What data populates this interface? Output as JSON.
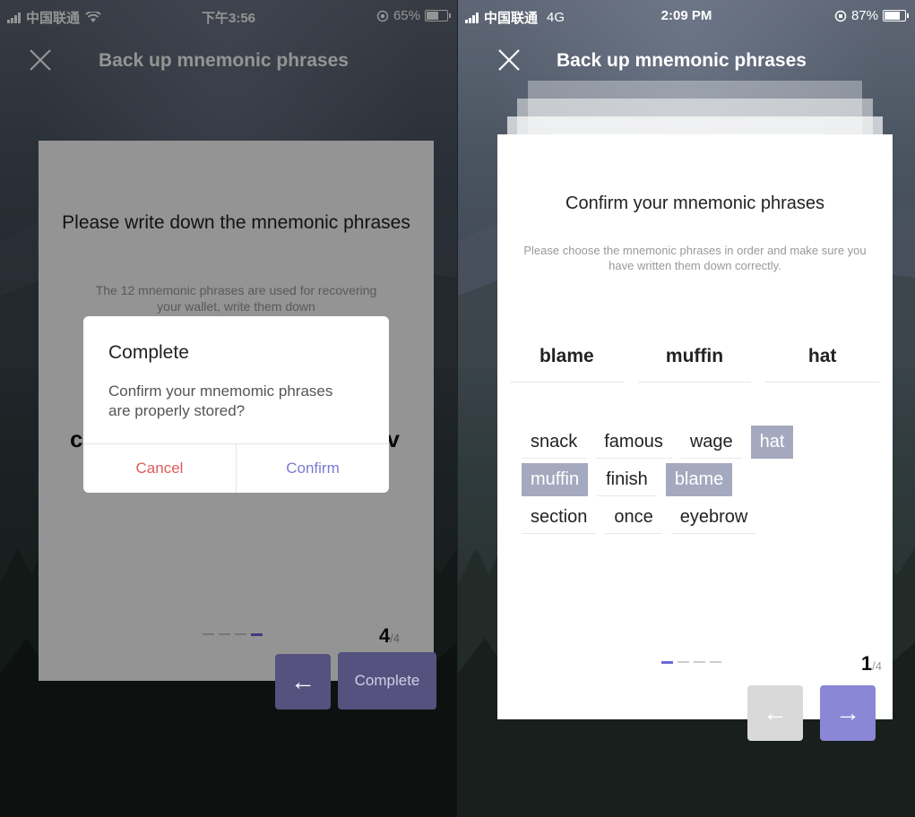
{
  "left": {
    "status": {
      "carrier": "中国联通",
      "time": "下午3:56",
      "battery": "65%",
      "battery_level": 0.65
    },
    "nav": {
      "title": "Back up mnemonic phrases"
    },
    "card": {
      "heading": "Please write down the mnemonic phrases",
      "description": "The 12 mnemonic phrases are used for recovering your wallet, write them down",
      "partial_left": "c",
      "partial_right": "v",
      "page_current": "4",
      "page_total": "/4",
      "active_dot": 3
    },
    "buttons": {
      "back_arrow": "←",
      "complete": "Complete"
    },
    "modal": {
      "title": "Complete",
      "message": "Confirm your mnemomic phrases are properly stored?",
      "cancel": "Cancel",
      "confirm": "Confirm"
    }
  },
  "right": {
    "status": {
      "carrier": "中国联通",
      "network": "4G",
      "time": "2:09 PM",
      "battery": "87%",
      "battery_level": 0.87
    },
    "nav": {
      "title": "Back up mnemonic phrases"
    },
    "card": {
      "heading": "Confirm your mnemonic phrases",
      "description": "Please choose the mnemonic phrases in order and make sure you have written them down correctly.",
      "selected_slots": [
        "blame",
        "muffin",
        "hat"
      ],
      "word_rows": [
        [
          {
            "text": "snack",
            "selected": false
          },
          {
            "text": "famous",
            "selected": false
          },
          {
            "text": "wage",
            "selected": false
          },
          {
            "text": "hat",
            "selected": true
          }
        ],
        [
          {
            "text": "muffin",
            "selected": true
          },
          {
            "text": "finish",
            "selected": false
          },
          {
            "text": "blame",
            "selected": true
          }
        ],
        [
          {
            "text": "section",
            "selected": false
          },
          {
            "text": "once",
            "selected": false
          },
          {
            "text": "eyebrow",
            "selected": false
          }
        ]
      ],
      "page_current": "1",
      "page_total": "/4",
      "active_dot": 0
    },
    "buttons": {
      "back_arrow": "←",
      "next_arrow": "→"
    }
  },
  "colors": {
    "accent": "#7b7bd6",
    "button_purple": "#8a87d6",
    "cancel_red": "#e05a5a",
    "chip_selected": "#a5a9bf",
    "disabled_button": "#d9d9d9"
  }
}
